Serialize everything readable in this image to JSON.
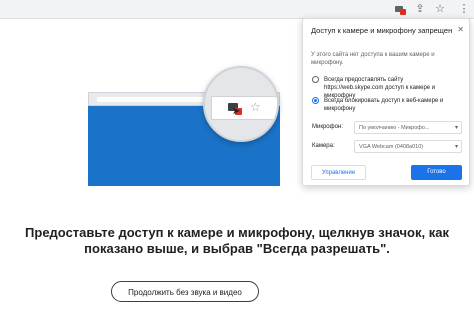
{
  "popup": {
    "title": "Доступ к камере и микрофону запрещен",
    "close_icon": "close-icon",
    "note": "У этого сайта нет доступа к вашим камере и микрофону.",
    "options": [
      {
        "label": "Всегда предоставлять сайту https://web.skype.com доступ к камере и микрофону",
        "selected": false
      },
      {
        "label": "Всегда блокировать доступ к веб-камере и микрофону",
        "selected": true
      }
    ],
    "mic_label": "Микрофон:",
    "mic_value": "По умолчанию - Микрофо...",
    "cam_label": "Камера:",
    "cam_value": "VGA Webcam (0408a010)",
    "manage_button": "Управление",
    "done_button": "Готово",
    "accent_color": "#1a73e8"
  },
  "toolbar": {
    "icons": [
      "camera-blocked-icon",
      "share-icon",
      "star-icon",
      "menu-icon"
    ]
  },
  "main": {
    "headline": "Предоставьте доступ к камере и микрофону, щелкнув значок, как показано выше, и выбрав \"Всегда разрешать\".",
    "continue_button": "Продолжить без звука и видео"
  }
}
